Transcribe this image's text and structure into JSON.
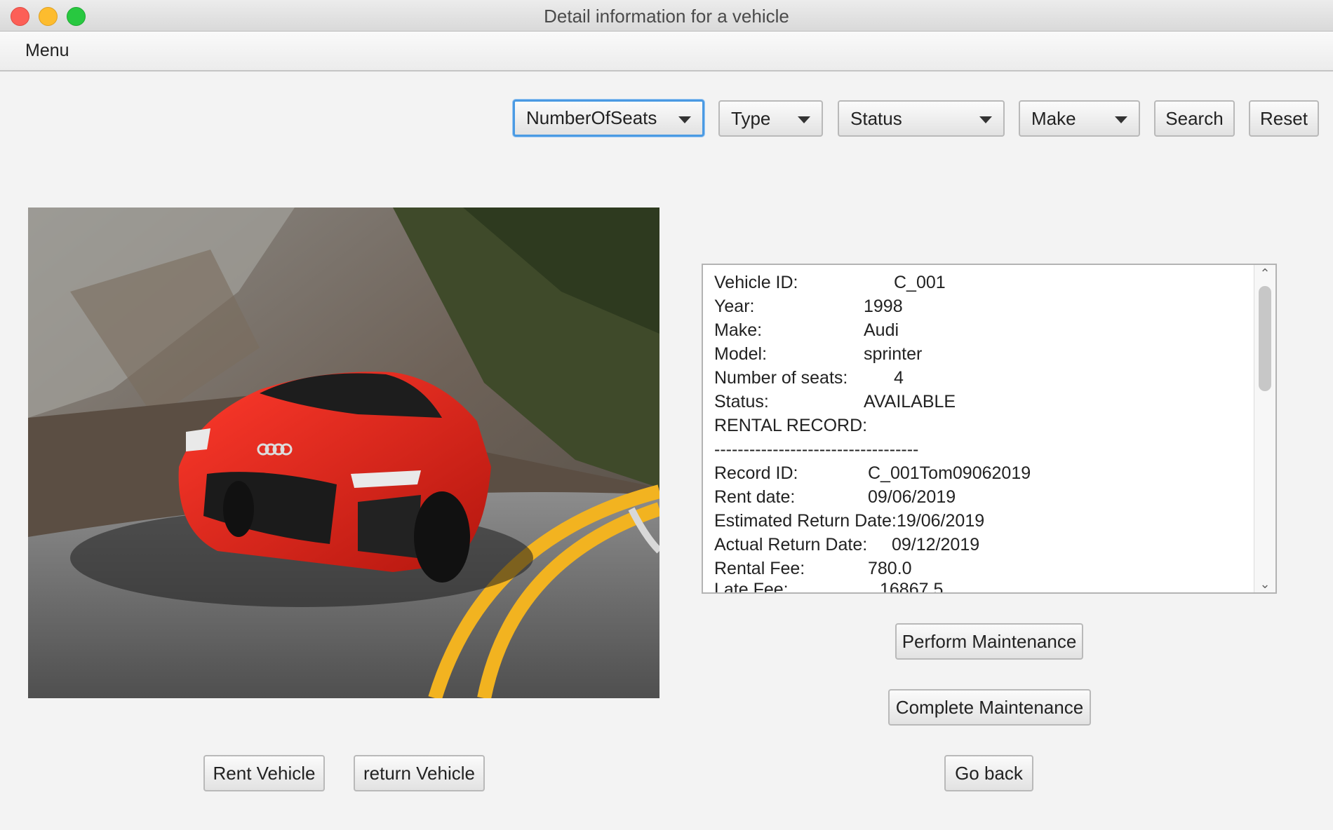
{
  "window": {
    "title": "Detail information for a vehicle"
  },
  "menu": {
    "label": "Menu"
  },
  "filters": {
    "seats": "NumberOfSeats",
    "type": "Type",
    "status": "Status",
    "make": "Make",
    "search_label": "Search",
    "reset_label": "Reset"
  },
  "details": {
    "vehicle_id": {
      "label": "Vehicle ID:",
      "value": "C_001"
    },
    "year": {
      "label": "Year:",
      "value": "1998"
    },
    "make": {
      "label": "Make:",
      "value": "Audi"
    },
    "model": {
      "label": "Model:",
      "value": "sprinter"
    },
    "seats": {
      "label": "Number of seats:",
      "value": "4"
    },
    "status": {
      "label": "Status:",
      "value": "AVAILABLE"
    },
    "rental_header": "RENTAL RECORD:",
    "separator": "-----------------------------------",
    "record_id": {
      "label": "Record ID:",
      "value": "C_001Tom09062019"
    },
    "rent_date": {
      "label": "Rent date:",
      "value": "09/06/2019"
    },
    "estimated_return": {
      "label": "Estimated Return Date:",
      "value": "19/06/2019"
    },
    "actual_return": {
      "label": "Actual Return Date:",
      "value": "09/12/2019"
    },
    "rental_fee": {
      "label": "Rental Fee:",
      "value": "780.0"
    },
    "late_fee": {
      "label": "Late Fee:",
      "value": "16867.5"
    }
  },
  "actions": {
    "perform_maintenance": "Perform Maintenance",
    "complete_maintenance": "Complete Maintenance",
    "rent_vehicle": "Rent Vehicle",
    "return_vehicle": "return Vehicle",
    "go_back": "Go back"
  },
  "colors": {
    "car": "#e0261b",
    "road_line": "#f2b320",
    "focus_ring": "#4a9ae3"
  }
}
